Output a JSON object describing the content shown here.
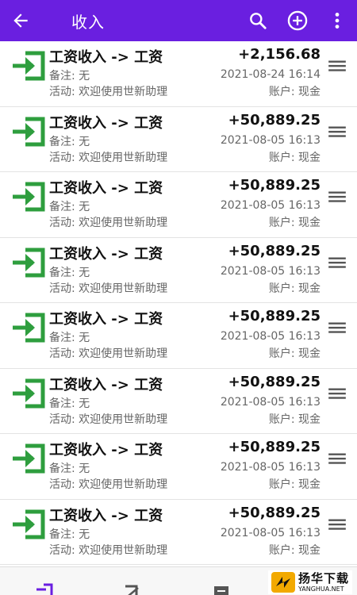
{
  "appbar": {
    "title": "收入",
    "background": "#6a1fe0"
  },
  "icons": {
    "back": "arrow-left-icon",
    "search": "search-icon",
    "add": "add-circle-icon",
    "more": "more-vert-icon",
    "income": "login-arrow-icon",
    "drag": "drag-handle-icon"
  },
  "entries": [
    {
      "title": "工资收入 -> 工资",
      "note": "备注: 无",
      "activity": "活动: 欢迎使用世新助理",
      "amount": "+2,156.68",
      "time": "2021-08-24 16:14",
      "account": "账户: 现金"
    },
    {
      "title": "工资收入 -> 工资",
      "note": "备注: 无",
      "activity": "活动: 欢迎使用世新助理",
      "amount": "+50,889.25",
      "time": "2021-08-05 16:13",
      "account": "账户: 现金"
    },
    {
      "title": "工资收入 -> 工资",
      "note": "备注: 无",
      "activity": "活动: 欢迎使用世新助理",
      "amount": "+50,889.25",
      "time": "2021-08-05 16:13",
      "account": "账户: 现金"
    },
    {
      "title": "工资收入 -> 工资",
      "note": "备注: 无",
      "activity": "活动: 欢迎使用世新助理",
      "amount": "+50,889.25",
      "time": "2021-08-05 16:13",
      "account": "账户: 现金"
    },
    {
      "title": "工资收入 -> 工资",
      "note": "备注: 无",
      "activity": "活动: 欢迎使用世新助理",
      "amount": "+50,889.25",
      "time": "2021-08-05 16:13",
      "account": "账户: 现金"
    },
    {
      "title": "工资收入 -> 工资",
      "note": "备注: 无",
      "activity": "活动: 欢迎使用世新助理",
      "amount": "+50,889.25",
      "time": "2021-08-05 16:13",
      "account": "账户: 现金"
    },
    {
      "title": "工资收入 -> 工资",
      "note": "备注: 无",
      "activity": "活动: 欢迎使用世新助理",
      "amount": "+50,889.25",
      "time": "2021-08-05 16:13",
      "account": "账户: 现金"
    },
    {
      "title": "工资收入 -> 工资",
      "note": "备注: 无",
      "activity": "活动: 欢迎使用世新助理",
      "amount": "+50,889.25",
      "time": "2021-08-05 16:13",
      "account": "账户: 现金"
    }
  ],
  "colors": {
    "income_icon": "#2e9e3e",
    "amount": "#111111"
  },
  "watermark": {
    "cn": "扬华下载",
    "en": "YANGHUA.NET"
  }
}
